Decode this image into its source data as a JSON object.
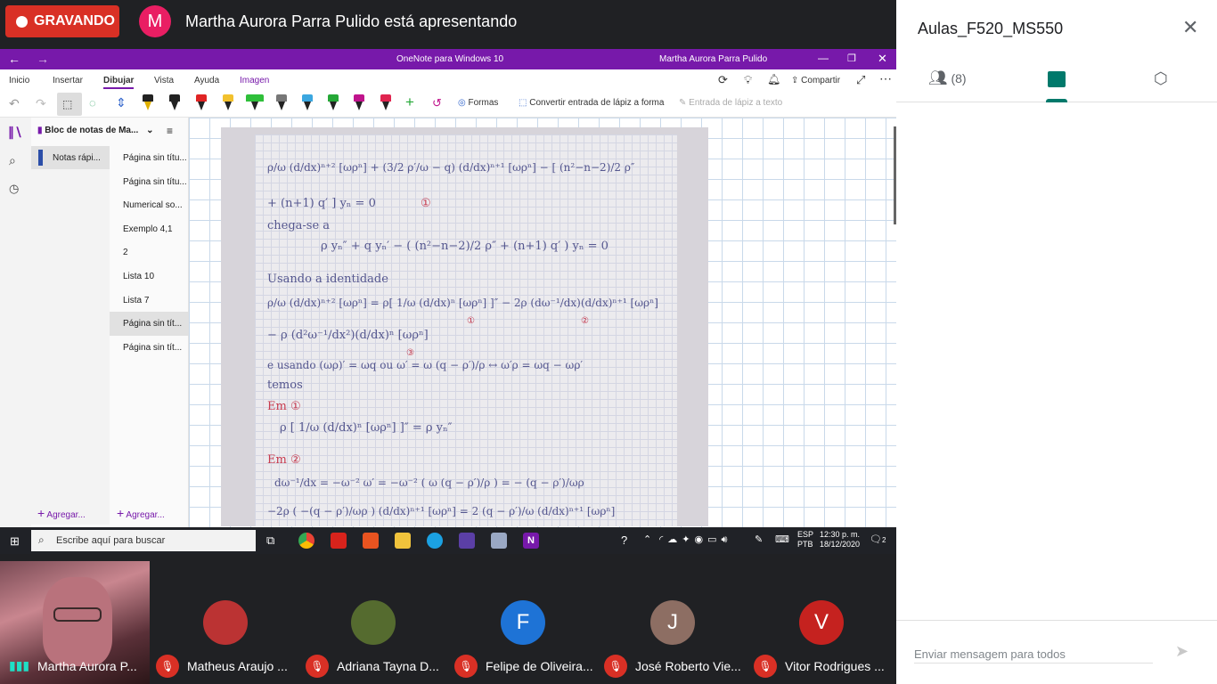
{
  "meet": {
    "recording_label": "GRAVANDO",
    "presenter_initial": "M",
    "presenting_text": "Martha Aurora Parra Pulido está apresentando"
  },
  "onenote": {
    "window_title": "OneNote para Windows 10",
    "user_name": "Martha Aurora Parra Pulido",
    "menu": [
      "Inicio",
      "Insertar",
      "Dibujar",
      "Vista",
      "Ayuda",
      "Imagen"
    ],
    "menu_active": "Dibujar",
    "toolbar": {
      "shapes_label": "Formas",
      "convert_shapes_label": "Convertir entrada de lápiz a forma",
      "ink_to_text_label": "Entrada de lápiz a texto",
      "share_label": "Compartir"
    },
    "notebook_name": "Bloc de notas de Ma...",
    "section": "Notas rápi...",
    "pages": [
      "Página sin títu...",
      "Página sin títu...",
      "Numerical so...",
      "Exemplo 4,1",
      "2",
      "Lista 10",
      "Lista 7",
      "Página sin tít...",
      "Página sin tít..."
    ],
    "selected_page_index": 7,
    "add_section_label": "Agregar...",
    "add_page_label": "Agregar...",
    "pen_colors": [
      "#222222",
      "#222222",
      "#e02424",
      "#f2c12e",
      "#2fbf3a",
      "#444444",
      "#3ba7e0",
      "#25a837",
      "#c0148c",
      "#e0244f"
    ]
  },
  "handwriting": {
    "line1": "ρ/ω (d/dx)ⁿ⁺² [ωρⁿ] + (3/2 ρ′/ω − q) (d/dx)ⁿ⁺¹ [ωρⁿ] − [ (n²−n−2)/2 ρ″",
    "line2": "+ (n+1) q′ ] yₙ = 0",
    "line3": "chega-se a",
    "line4": "ρ yₙ″ + q yₙ′ − ( (n²−n−2)/2 ρ″ + (n+1) q′ ) yₙ = 0",
    "line5": "Usando a identidade",
    "line6": "ρ/ω (d/dx)ⁿ⁺² [ωρⁿ] = ρ[ 1/ω (d/dx)ⁿ [ωρⁿ] ]″ − 2ρ (dω⁻¹/dx)(d/dx)ⁿ⁺¹ [ωρⁿ]",
    "line7": "− ρ (d²ω⁻¹/dx²)(d/dx)ⁿ [ωρⁿ]",
    "line8": "e usando (ωρ)′ = ωq  ou  ω′ = ω (q − ρ′)/ρ  ↔  ω′ρ = ωq − ωρ′",
    "line9": "temos",
    "line10": "Em ①",
    "line11": "ρ [ 1/ω (d/dx)ⁿ [ωρⁿ] ]″ = ρ yₙ″",
    "line12": "Em ②",
    "line13": "dω⁻¹/dx = −ω⁻² ω′ = −ω⁻² ( ω (q − ρ′)/ρ ) = − (q − ρ′)/ωρ",
    "line14": "−2ρ ( −(q − ρ′)/ωρ ) (d/dx)ⁿ⁺¹ [ωρⁿ] = 2 (q − ρ′)/ω (d/dx)ⁿ⁺¹ [ωρⁿ]",
    "marks": [
      "①",
      "②",
      "③"
    ]
  },
  "taskbar": {
    "search_placeholder": "Escribe aquí para buscar",
    "lang_top": "ESP",
    "lang_bottom": "PTB",
    "time": "12:30 p. m.",
    "date": "18/12/2020",
    "notifications": "2"
  },
  "participants": {
    "self_name": "Martha Aurora P...",
    "list": [
      {
        "name": "Matheus Araujo ...",
        "initial": "",
        "color": "#ffffff"
      },
      {
        "name": "Adriana Tayna D...",
        "initial": "",
        "color": "#ffffff"
      },
      {
        "name": "Felipe de Oliveira...",
        "initial": "F",
        "color": "#1e73d6"
      },
      {
        "name": "José Roberto Vie...",
        "initial": "J",
        "color": "#8d6e63"
      },
      {
        "name": "Vitor Rodrigues ...",
        "initial": "V",
        "color": "#c5221f"
      }
    ]
  },
  "panel": {
    "title": "Aulas_F520_MS550",
    "people_count": "(8)",
    "message_placeholder": "Enviar mensagem para todos",
    "accent": "#00796b"
  }
}
